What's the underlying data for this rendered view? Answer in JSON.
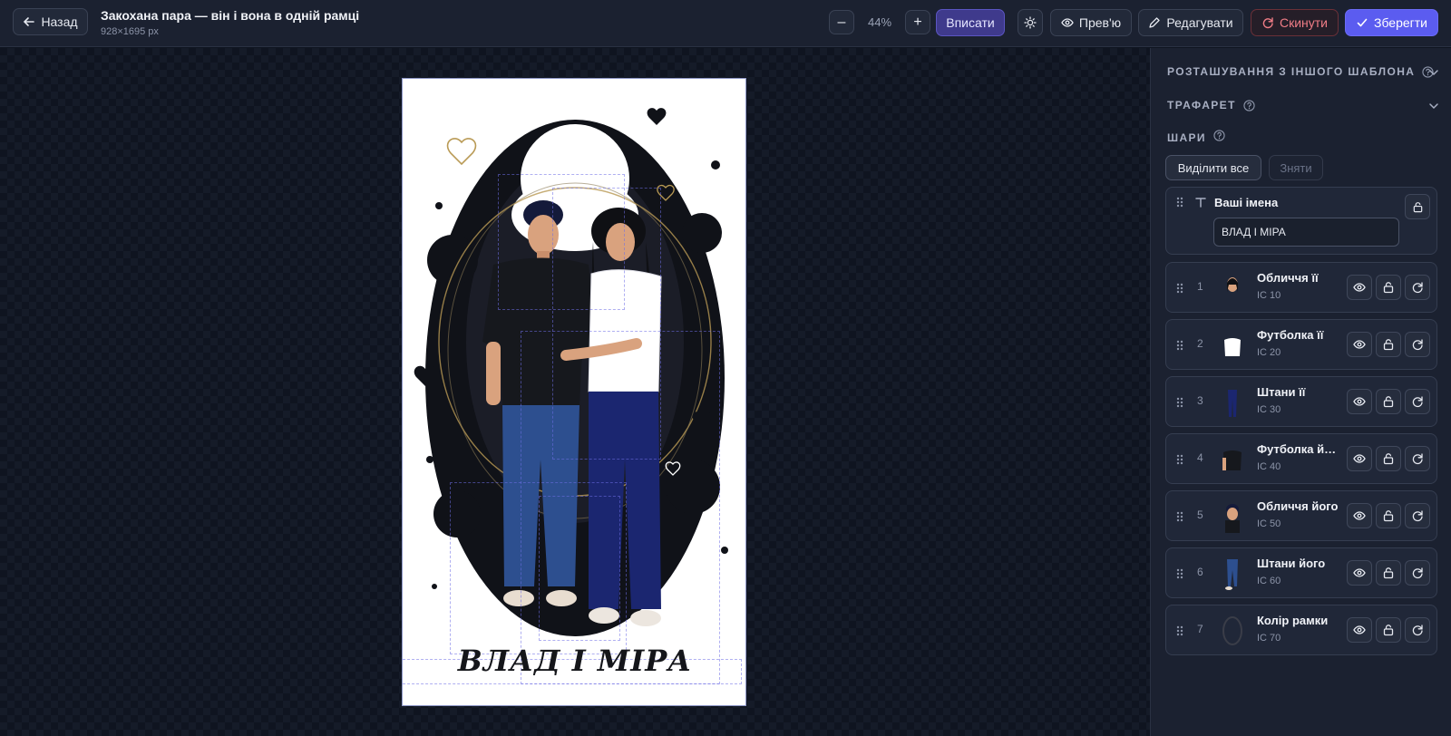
{
  "header": {
    "back_label": "Назад",
    "title": "Закохана пара — він і вона в одній рамці",
    "dimensions": "928×1695 px",
    "zoom_minus": "–",
    "zoom_value": "44%",
    "zoom_plus": "+",
    "fit_label": "Вписати",
    "preview_label": "Прев'ю",
    "edit_label": "Редагувати",
    "reset_label": "Скинути",
    "save_label": "Зберегти"
  },
  "artboard": {
    "names_text": "ВЛАД І МІРА"
  },
  "panel": {
    "placement_title": "РОЗТАШУВАННЯ З ІНШОГО ШАБЛОНА",
    "stencil_title": "ТРАФАРЕТ",
    "layers_title": "ШАРИ",
    "select_all_label": "Виділити все",
    "deselect_label": "Зняти",
    "text_layer": {
      "label": "Ваші імена",
      "value": "ВЛАД І МІРА"
    },
    "layers": [
      {
        "num": "1",
        "name": "Обличчя її",
        "code": "IC 10"
      },
      {
        "num": "2",
        "name": "Футболка її",
        "code": "IC 20"
      },
      {
        "num": "3",
        "name": "Штани її",
        "code": "IC 30"
      },
      {
        "num": "4",
        "name": "Футболка його",
        "code": "IC 40"
      },
      {
        "num": "5",
        "name": "Обличчя його",
        "code": "IC 50"
      },
      {
        "num": "6",
        "name": "Штани його",
        "code": "IC 60"
      },
      {
        "num": "7",
        "name": "Колір рамки",
        "code": "IC 70"
      }
    ]
  },
  "colors": {
    "accent": "#5b5cf0",
    "fit_button": "#3f3a8c",
    "reset": "#f07d86",
    "panel_bg": "#1b2130"
  },
  "icons": [
    "arrow-left-icon",
    "sun-icon",
    "eye-icon",
    "pencil-icon",
    "refresh-icon",
    "check-icon",
    "help-icon",
    "chevron-down-icon",
    "drag-handle-icon",
    "text-icon",
    "lock-icon"
  ]
}
